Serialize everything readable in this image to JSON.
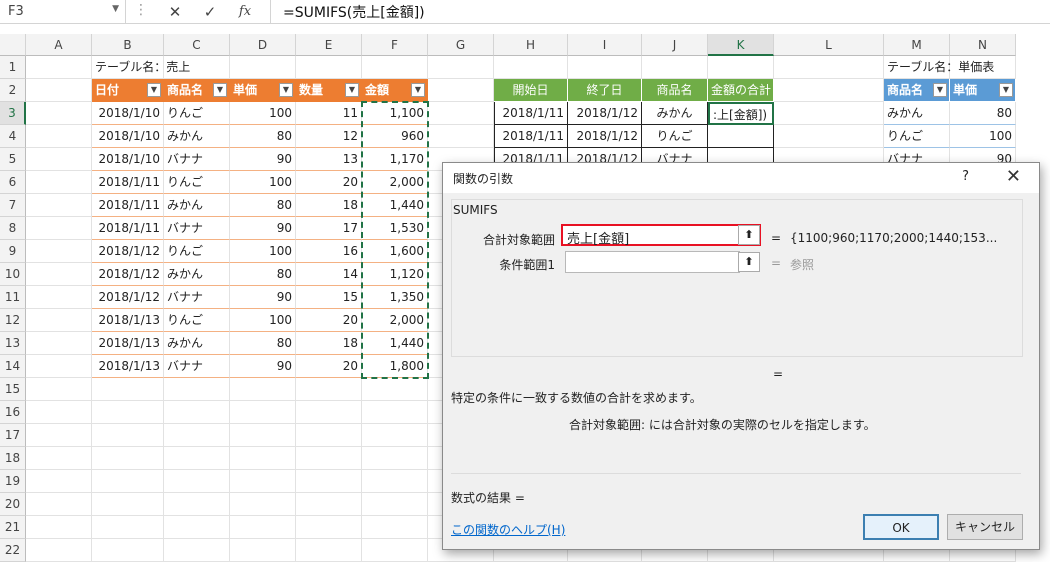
{
  "formula_bar": {
    "name_box": "F3",
    "cancel": "✕",
    "enter": "✓",
    "fx": "fx",
    "formula": "=SUMIFS(売上[金額])"
  },
  "columns": [
    "A",
    "B",
    "C",
    "D",
    "E",
    "F",
    "G",
    "H",
    "I",
    "J",
    "K",
    "L",
    "M",
    "N"
  ],
  "rows": [
    "1",
    "2",
    "3",
    "4",
    "5",
    "6",
    "7",
    "8",
    "9",
    "10",
    "11",
    "12",
    "13",
    "14",
    "15",
    "16",
    "17",
    "18",
    "19",
    "20",
    "21",
    "22"
  ],
  "sheet": {
    "b1": "テーブル名：売上",
    "sales_headers": [
      "日付",
      "商品名",
      "単価",
      "数量",
      "金額"
    ],
    "sales_rows": [
      [
        "2018/1/10",
        "りんご",
        "100",
        "11",
        "1,100"
      ],
      [
        "2018/1/10",
        "みかん",
        "80",
        "12",
        "960"
      ],
      [
        "2018/1/10",
        "バナナ",
        "90",
        "13",
        "1,170"
      ],
      [
        "2018/1/11",
        "りんご",
        "100",
        "20",
        "2,000"
      ],
      [
        "2018/1/11",
        "みかん",
        "80",
        "18",
        "1,440"
      ],
      [
        "2018/1/11",
        "バナナ",
        "90",
        "17",
        "1,530"
      ],
      [
        "2018/1/12",
        "りんご",
        "100",
        "16",
        "1,600"
      ],
      [
        "2018/1/12",
        "みかん",
        "80",
        "14",
        "1,120"
      ],
      [
        "2018/1/12",
        "バナナ",
        "90",
        "15",
        "1,350"
      ],
      [
        "2018/1/13",
        "りんご",
        "100",
        "20",
        "2,000"
      ],
      [
        "2018/1/13",
        "みかん",
        "80",
        "18",
        "1,440"
      ],
      [
        "2018/1/13",
        "バナナ",
        "90",
        "20",
        "1,800"
      ]
    ],
    "criteria_headers": [
      "開始日",
      "終了日",
      "商品名",
      "金額の合計"
    ],
    "criteria_rows": [
      [
        "2018/1/11",
        "2018/1/12",
        "みかん",
        ":上[金額])"
      ],
      [
        "2018/1/11",
        "2018/1/12",
        "りんご",
        ""
      ],
      [
        "2018/1/11",
        "2018/1/12",
        "バナナ",
        ""
      ]
    ],
    "m1": "テーブル名：単価表",
    "price_headers": [
      "商品名",
      "単価"
    ],
    "price_rows": [
      [
        "みかん",
        "80"
      ],
      [
        "りんご",
        "100"
      ],
      [
        "バナナ",
        "90"
      ]
    ]
  },
  "dialog": {
    "title": "関数の引数",
    "help": "?",
    "close": "✕",
    "function_name": "SUMIFS",
    "arg1_label": "合計対象範囲",
    "arg1_value": "売上[金額]",
    "arg1_result": "{1100;960;1170;2000;1440;153...",
    "arg2_label": "条件範囲1",
    "arg2_value": "",
    "arg2_result": "参照",
    "equals": "=",
    "description": "特定の条件に一致する数値の合計を求めます。",
    "arg_description": "合計対象範囲:  には合計対象の実際のセルを指定します。",
    "result_label": "数式の結果 =",
    "help_link": "この関数のヘルプ(H)",
    "ok": "OK",
    "cancel": "キャンセル",
    "collapse_glyph": "⬆"
  },
  "colors": {
    "orange": "#ed7d31",
    "green": "#70ad47",
    "blue": "#5b9bd5",
    "excel_green": "#217346",
    "highlight_red": "#e81123"
  }
}
